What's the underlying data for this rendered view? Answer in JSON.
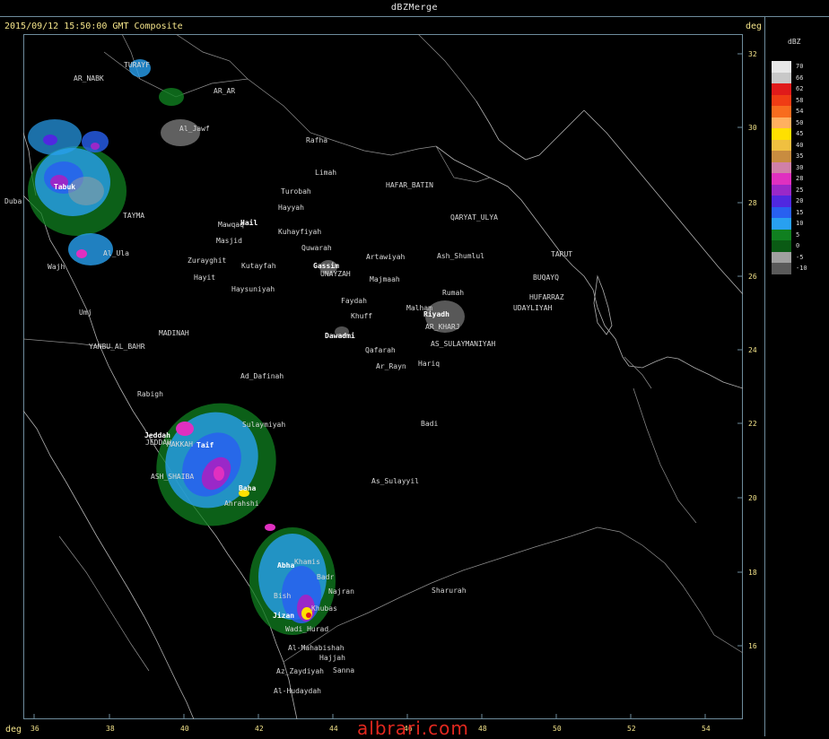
{
  "title": "dBZMerge",
  "header": "2015/09/12 15:50:00 GMT Composite",
  "deg_label": "deg",
  "legend": {
    "unit": "dBZ",
    "items": [
      {
        "label": "70",
        "color": "#e8e8e8"
      },
      {
        "label": "66",
        "color": "#c8c8c8"
      },
      {
        "label": "62",
        "color": "#e01a1a"
      },
      {
        "label": "58",
        "color": "#f03c14"
      },
      {
        "label": "54",
        "color": "#f86c1e"
      },
      {
        "label": "50",
        "color": "#ffb060"
      },
      {
        "label": "45",
        "color": "#ffe000"
      },
      {
        "label": "40",
        "color": "#f0c040"
      },
      {
        "label": "35",
        "color": "#c88c40"
      },
      {
        "label": "30",
        "color": "#d080a8"
      },
      {
        "label": "28",
        "color": "#e030c0"
      },
      {
        "label": "25",
        "color": "#9a28c8"
      },
      {
        "label": "20",
        "color": "#5028e0"
      },
      {
        "label": "15",
        "color": "#2860f0"
      },
      {
        "label": "10",
        "color": "#28a0f0"
      },
      {
        "label": "5",
        "color": "#108020"
      },
      {
        "label": "0",
        "color": "#0a5a14"
      },
      {
        "label": "-5",
        "color": "#a0a0a0"
      },
      {
        "label": "-10",
        "color": "#5a5a5a"
      }
    ]
  },
  "lat_ticks": [
    "32",
    "30",
    "28",
    "26",
    "24",
    "22",
    "20",
    "18",
    "16"
  ],
  "lon_ticks": [
    "36",
    "38",
    "40",
    "42",
    "44",
    "46",
    "48",
    "50",
    "52",
    "54"
  ],
  "cities": [
    {
      "name": "TURAYF"
    },
    {
      "name": "AR_NABK"
    },
    {
      "name": "AR_AR"
    },
    {
      "name": "Al_Jawf"
    },
    {
      "name": "Rafha"
    },
    {
      "name": "Limah"
    },
    {
      "name": "HAFAR_BATIN"
    },
    {
      "name": "Turobah"
    },
    {
      "name": "Tabuk"
    },
    {
      "name": "Duba"
    },
    {
      "name": "TAYMA"
    },
    {
      "name": "Hayyah"
    },
    {
      "name": "Hail"
    },
    {
      "name": "Mawqaq"
    },
    {
      "name": "Kuhayfiyah"
    },
    {
      "name": "QARYAT_ULYA"
    },
    {
      "name": "Masjid"
    },
    {
      "name": "Quwarah"
    },
    {
      "name": "Artawiyah"
    },
    {
      "name": "Ash_Shumlul"
    },
    {
      "name": "TARUT"
    },
    {
      "name": "Al_Ula"
    },
    {
      "name": "Zurayghit"
    },
    {
      "name": "Kutayfah"
    },
    {
      "name": "Gassim"
    },
    {
      "name": "UNAYZAH"
    },
    {
      "name": "BUQAYQ"
    },
    {
      "name": "Wajh"
    },
    {
      "name": "Hayit"
    },
    {
      "name": "Majmaah"
    },
    {
      "name": "Haysuniyah"
    },
    {
      "name": "Rumah"
    },
    {
      "name": "HUFARRAZ"
    },
    {
      "name": "Faydah"
    },
    {
      "name": "Malham"
    },
    {
      "name": "UDAYLIYAH"
    },
    {
      "name": "Umj"
    },
    {
      "name": "Khuff"
    },
    {
      "name": "Riyadh"
    },
    {
      "name": "MADINAH"
    },
    {
      "name": "Dawadmi"
    },
    {
      "name": "AR_KHARJ"
    },
    {
      "name": "YANBU_AL_BAHR"
    },
    {
      "name": "Qafarah"
    },
    {
      "name": "AS_SULAYMANIYAH"
    },
    {
      "name": "Ad_Dafinah"
    },
    {
      "name": "Ar_Rayn"
    },
    {
      "name": "Hariq"
    },
    {
      "name": "Rabigh"
    },
    {
      "name": "Sulaymiyah"
    },
    {
      "name": "Badi"
    },
    {
      "name": "Jeddah"
    },
    {
      "name": "JEDDAH"
    },
    {
      "name": "MAKKAH"
    },
    {
      "name": "Taif"
    },
    {
      "name": "ASH_SHAIBA"
    },
    {
      "name": "As_Sulayyil"
    },
    {
      "name": "Baha"
    },
    {
      "name": "Ahrahshi"
    },
    {
      "name": "Abha"
    },
    {
      "name": "Khamis"
    },
    {
      "name": "Badr"
    },
    {
      "name": "Najran"
    },
    {
      "name": "Sharurah"
    },
    {
      "name": "Bish"
    },
    {
      "name": "Jizan"
    },
    {
      "name": "Khubas"
    },
    {
      "name": "Wadi_Hurad"
    },
    {
      "name": "Al-Mahabishah"
    },
    {
      "name": "Hajjah"
    },
    {
      "name": "Az_Zaydiyah"
    },
    {
      "name": "Sanna"
    },
    {
      "name": "Al-Hudaydah"
    }
  ],
  "watermark": "albrari.com"
}
